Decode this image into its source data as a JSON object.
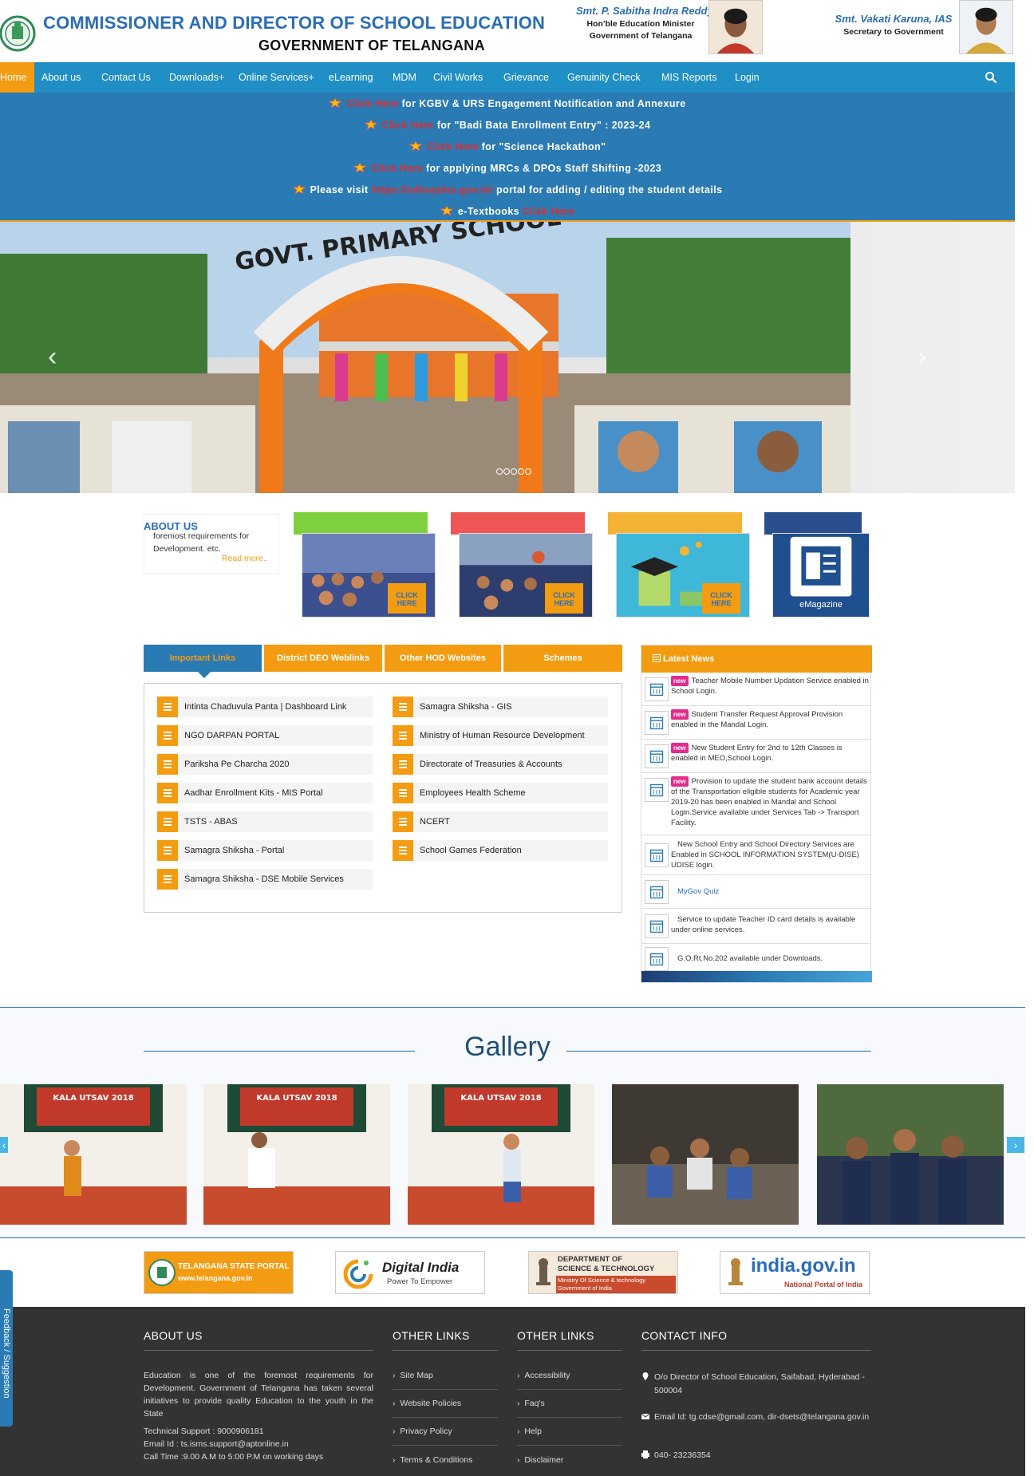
{
  "header": {
    "title": "COMMISSIONER AND DIRECTOR OF SCHOOL EDUCATION",
    "subtitle": "GOVERNMENT OF TELANGANA",
    "minister": {
      "name": "Smt. P. Sabitha Indra Reddy",
      "role1": "Hon'ble Education Minister",
      "role2": "Government of Telangana"
    },
    "secretary": {
      "name": "Smt. Vakati Karuna, IAS",
      "role": "Secretary to Government"
    }
  },
  "nav": {
    "items": [
      "Home",
      "About us",
      "Contact Us",
      "Downloads+",
      "Online Services+",
      "eLearning",
      "MDM",
      "Civil Works",
      "Grievance",
      "Genuinity Check",
      "MIS Reports",
      "Login"
    ],
    "search_icon": "search-icon"
  },
  "notices": [
    {
      "pre": "",
      "red": "Click Here",
      "post": " for KGBV & URS Engagement Notification and Annexure"
    },
    {
      "pre": "",
      "red": "Click Here",
      "post": " for \"Badi Bata Enrollment Entry\" : 2023-24"
    },
    {
      "pre": "",
      "red": "Click Here",
      "post": " for \"Science Hackathon\""
    },
    {
      "pre": "",
      "red": "Click Here",
      "post": " for applying MRCs & DPOs Staff Shifting -2023"
    },
    {
      "pre": "Please visit ",
      "red": "https://udiseplus.gov.in/",
      "post": " portal for adding / editing the student details"
    },
    {
      "pre": "e-Textbooks ",
      "red": "Click Here",
      "post": ""
    }
  ],
  "slider": {
    "school_arch": "GOVT. PRIMARY SCHOOL",
    "dots": 5,
    "prev": "‹",
    "next": "›"
  },
  "about": {
    "title": "ABOUT US",
    "snippet": "foremost requirements for Development. etc.",
    "read_more": "Read more.."
  },
  "tiles": [
    {
      "bar_color": "#7ed03e",
      "label": "CLICK HERE"
    },
    {
      "bar_color": "#f05555",
      "label": "CLICK HERE"
    },
    {
      "bar_color": "#f5b335",
      "label": "CLICK HERE"
    },
    {
      "bar_color": "#2a4f8f",
      "label": "eMagazine"
    }
  ],
  "tabs": [
    "Important Links",
    "District DEO Weblinks",
    "Other HOD Websites",
    "Schemes"
  ],
  "links_left": [
    "Intinta Chaduvula Panta | Dashboard Link",
    "NGO DARPAN PORTAL",
    "Pariksha Pe Charcha 2020",
    "Aadhar Enrollment Kits - MIS Portal",
    "TSTS - ABAS",
    "Samagra Shiksha - Portal",
    "Samagra Shiksha - DSE Mobile Services"
  ],
  "links_right": [
    "Samagra Shiksha - GIS",
    "Ministry of Human Resource Development",
    "Directorate of Treasuries & Accounts",
    "Employees Health Scheme",
    "NCERT",
    "School Games Federation"
  ],
  "news": {
    "title": "Latest News",
    "badge": "new",
    "items": [
      {
        "new": true,
        "text": "Teacher Mobile Number Updation Service enabled in School Login."
      },
      {
        "new": true,
        "text": "Student Transfer Request Approval Provision enabled in the Mandal Login."
      },
      {
        "new": true,
        "text": "New Student Entry for 2nd to 12th Classes is enabled in MEO,School Login."
      },
      {
        "new": true,
        "text": "Provision to update the student bank account details of the Transportation eligible students for Academic year 2019-20 has been enabled in Mandal and School Login.Service available under Services Tab -> Transport Facility."
      },
      {
        "new": false,
        "text": "New School Entry and School Directory Services are Enabled in SCHOOL INFORMATION SYSTEM(U-DISE) UDISE login."
      },
      {
        "new": false,
        "text": "MyGov Quiz"
      },
      {
        "new": false,
        "text": "Service to update Teacher ID card details is available under online services."
      },
      {
        "new": false,
        "text": "G.O.Rt.No.202 available under Downloads."
      }
    ]
  },
  "gallery": {
    "title": "Gallery",
    "banner_text": "KALA UTSAV 2018"
  },
  "partners": [
    {
      "line1": "TELANGANA STATE PORTAL",
      "line2": "www.telangana.gov.in"
    },
    {
      "line1": "Digital India",
      "line2": "Power To Empower"
    },
    {
      "line1": "DEPARTMENT OF",
      "line2": "SCIENCE & TECHNOLOGY",
      "line3": "Ministry Of Science & technology",
      "line4": "Government of India"
    },
    {
      "line1": "india.gov.in",
      "line2": "National Portal of India"
    }
  ],
  "footer": {
    "about_title": "ABOUT US",
    "about_text": "Education is one of the foremost requirements for Development. Government of Telangana has taken several initiatives to provide quality Education to the youth in the State",
    "tech_support": "Technical Support : 9000906181",
    "email_id": "Email Id : ts.isms.support@aptonline.in",
    "call_time": "Call Time :9.00 A.M to 5:00 P.M on working days",
    "other_links_title": "OTHER LINKS",
    "other_links_1": [
      "Site Map",
      "Website Policies",
      "Privacy Policy",
      "Terms & Conditions"
    ],
    "other_links_2": [
      "Accessibility",
      "Faq's",
      "Help",
      "Disclaimer"
    ],
    "contact_title": "CONTACT INFO",
    "address": "O/o Director of School Education, Saifabad, Hyderabad - 500004",
    "email": "Email Id: tg.cdse@gmail.com, dir-dsets@telangana.gov.in",
    "phone": "040- 23236354"
  },
  "feedback": "Feedback / Suggestion",
  "colors": {
    "nav": "#1f8fc5",
    "accent": "#f39c12",
    "brand_blue": "#2a6db5",
    "notice_bg": "#2a7ab3",
    "footer": "#333333"
  }
}
